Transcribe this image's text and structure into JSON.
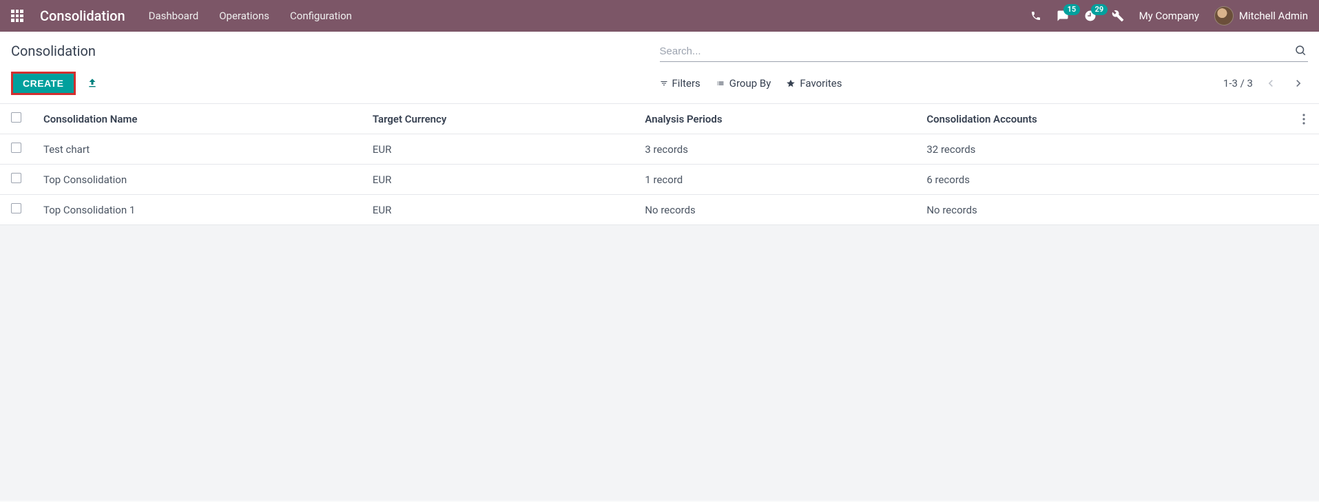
{
  "navbar": {
    "brand": "Consolidation",
    "links": [
      "Dashboard",
      "Operations",
      "Configuration"
    ],
    "messages_count": "15",
    "activities_count": "29",
    "company": "My Company",
    "user": "Mitchell Admin"
  },
  "breadcrumb": "Consolidation",
  "search": {
    "placeholder": "Search..."
  },
  "toolbar": {
    "create_label": "CREATE",
    "filters_label": "Filters",
    "groupby_label": "Group By",
    "favorites_label": "Favorites",
    "pager_text": "1-3 / 3"
  },
  "table": {
    "headers": {
      "name": "Consolidation Name",
      "currency": "Target Currency",
      "periods": "Analysis Periods",
      "accounts": "Consolidation Accounts"
    },
    "rows": [
      {
        "name": "Test chart",
        "currency": "EUR",
        "periods": "3 records",
        "accounts": "32 records"
      },
      {
        "name": "Top Consolidation",
        "currency": "EUR",
        "periods": "1 record",
        "accounts": "6 records"
      },
      {
        "name": "Top Consolidation 1",
        "currency": "EUR",
        "periods": "No records",
        "accounts": "No records"
      }
    ]
  }
}
